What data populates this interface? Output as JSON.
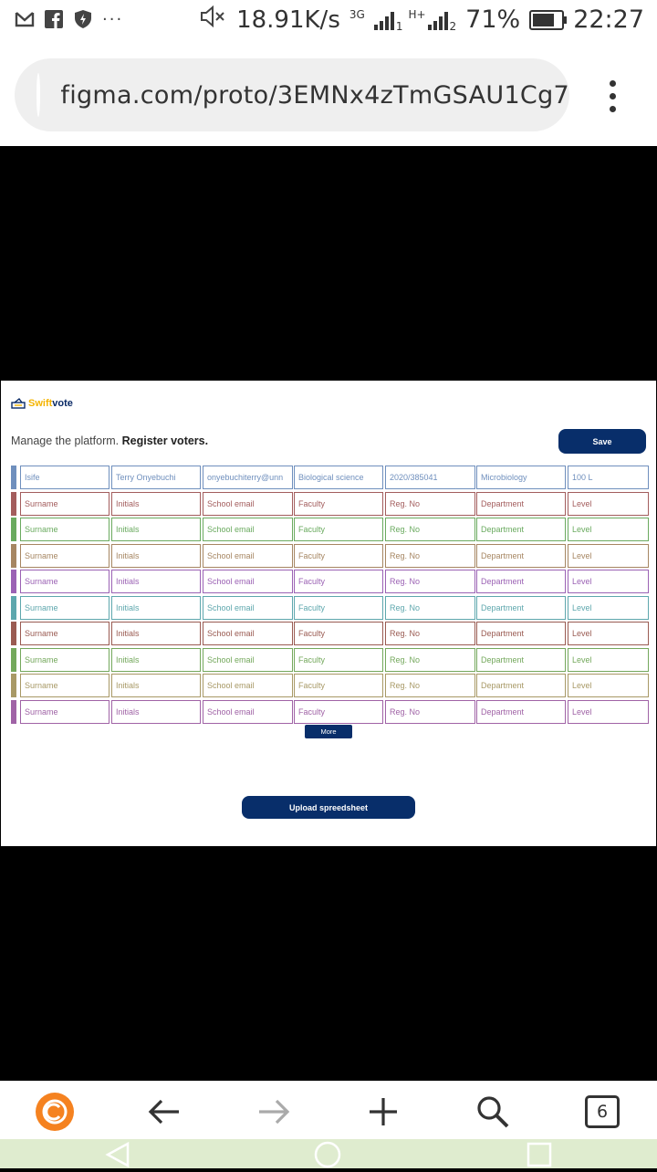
{
  "status_bar": {
    "network_speed": "18.91K/s",
    "network_type": "3G",
    "sim1": "1",
    "sim2_type": "H+",
    "sim2": "2",
    "battery": "71%",
    "time": "22:27",
    "notification_icons": [
      "gmail-icon",
      "facebook-icon",
      "shield-icon",
      "more-dots-icon"
    ]
  },
  "browser": {
    "url": "figma.com/proto/3EMNx4zTmGSAU1Cg7",
    "tab_count": "6"
  },
  "app": {
    "logo_prefix": "Swift",
    "logo_suffix": "vote",
    "subtitle_plain": "Manage the platform.",
    "subtitle_bold": "Register voters.",
    "save_label": "Save",
    "more_label": "More",
    "upload_label": "Upload spreedsheet"
  },
  "table": {
    "rows": [
      {
        "color": "#6f8fbd",
        "cells": [
          "Isife",
          "Terry Onyebuchi",
          "onyebuchiterry@unn",
          "Biological science",
          "2020/385041",
          "Microbiology",
          "100 L"
        ]
      },
      {
        "color": "#a35d5d",
        "cells": [
          "Surname",
          "Initials",
          "School email",
          "Faculty",
          "Reg. No",
          "Department",
          "Level"
        ]
      },
      {
        "color": "#6aaa5f",
        "cells": [
          "Surname",
          "Initials",
          "School email",
          "Faculty",
          "Reg. No",
          "Department",
          "Level"
        ]
      },
      {
        "color": "#a68662",
        "cells": [
          "Surname",
          "Initials",
          "School email",
          "Faculty",
          "Reg. No",
          "Department",
          "Level"
        ]
      },
      {
        "color": "#9b62b4",
        "cells": [
          "Surname",
          "Initials",
          "School email",
          "Faculty",
          "Reg. No",
          "Department",
          "Level"
        ]
      },
      {
        "color": "#5ea7ad",
        "cells": [
          "Surname",
          "Initials",
          "School email",
          "Faculty",
          "Reg. No",
          "Department",
          "Level"
        ]
      },
      {
        "color": "#9a5b52",
        "cells": [
          "Surname",
          "Initials",
          "School email",
          "Faculty",
          "Reg. No",
          "Department",
          "Level"
        ]
      },
      {
        "color": "#74a85c",
        "cells": [
          "Surname",
          "Initials",
          "School email",
          "Faculty",
          "Reg. No",
          "Department",
          "Level"
        ]
      },
      {
        "color": "#a89966",
        "cells": [
          "Surname",
          "Initials",
          "School email",
          "Faculty",
          "Reg. No",
          "Department",
          "Level"
        ]
      },
      {
        "color": "#a063a6",
        "cells": [
          "Surname",
          "Initials",
          "School email",
          "Faculty",
          "Reg. No",
          "Department",
          "Level"
        ]
      }
    ]
  },
  "colors": {
    "brand_dark": "#082e6a",
    "logo_yellow": "#f4b400",
    "nav_bg": "#dfeccf",
    "browser_logo_orange": "#f58220"
  }
}
